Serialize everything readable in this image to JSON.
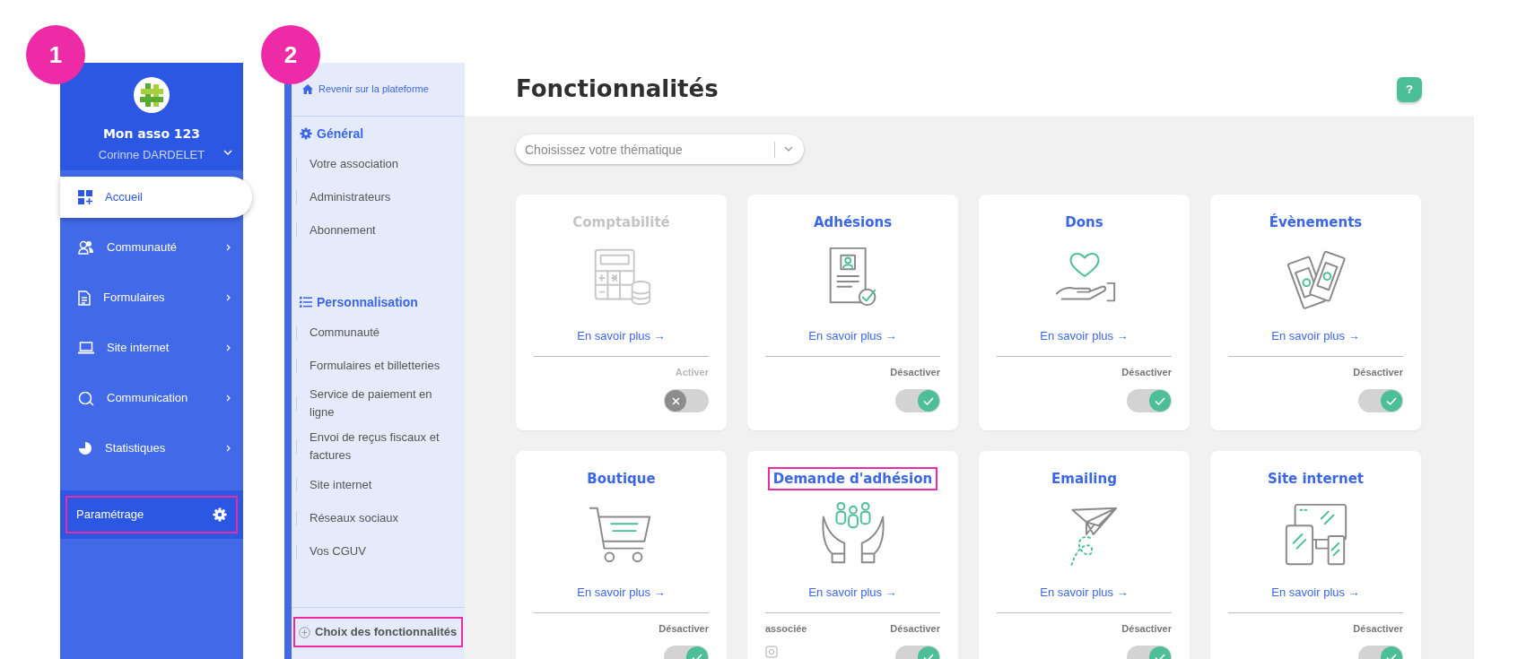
{
  "annotations": [
    {
      "number": "1"
    },
    {
      "number": "2"
    }
  ],
  "sidebar": {
    "org_name": "Mon asso 123",
    "user_name": "Corinne DARDELET",
    "items": [
      {
        "label": "Accueil",
        "selected": true,
        "expandable": false
      },
      {
        "label": "Communauté",
        "selected": false,
        "expandable": true
      },
      {
        "label": "Formulaires",
        "selected": false,
        "expandable": true
      },
      {
        "label": "Site internet",
        "selected": false,
        "expandable": true
      },
      {
        "label": "Communication",
        "selected": false,
        "expandable": true
      },
      {
        "label": "Statistiques",
        "selected": false,
        "expandable": true
      }
    ],
    "settings": {
      "label": "Paramétrage",
      "highlighted": true
    }
  },
  "settings_menu": {
    "back_link": "Revenir sur la plateforme",
    "sections": [
      {
        "title": "Général",
        "items": [
          "Votre association",
          "Administrateurs",
          "Abonnement"
        ]
      },
      {
        "title": "Personnalisation",
        "items": [
          "Communauté",
          "Formulaires et billetteries",
          "Service de paiement en ligne",
          "Envoi de reçus fiscaux et factures",
          "Site internet",
          "Réseaux sociaux",
          "Vos CGUV"
        ]
      }
    ],
    "footer": {
      "label": "Choix des fonctionnalités",
      "highlighted": true
    }
  },
  "main": {
    "title": "Fonctionnalités",
    "help": "?",
    "filter": {
      "placeholder": "Choisissez votre thématique"
    },
    "cards": [
      {
        "title": "Comptabilité",
        "link": "En savoir plus →",
        "toggle_label": "Activer",
        "checked": false,
        "highlighted": false
      },
      {
        "title": "Adhésions",
        "link": "En savoir plus →",
        "toggle_label": "Désactiver",
        "checked": true,
        "highlighted": false
      },
      {
        "title": "Dons",
        "link": "En savoir plus →",
        "toggle_label": "Désactiver",
        "checked": true,
        "highlighted": false
      },
      {
        "title": "Évènements",
        "link": "En savoir plus →",
        "toggle_label": "Désactiver",
        "checked": true,
        "highlighted": false
      },
      {
        "title": "Boutique",
        "link": "En savoir plus →",
        "toggle_label": "Désactiver",
        "checked": true,
        "highlighted": false
      },
      {
        "title": "Demande d'adhésion",
        "link": "En savoir plus →",
        "toggle_label": "Désactiver",
        "checked": true,
        "highlighted": true,
        "note": "associée"
      },
      {
        "title": "Emailing",
        "link": "En savoir plus →",
        "toggle_label": "Désactiver",
        "checked": true,
        "highlighted": false
      },
      {
        "title": "Site internet",
        "link": "En savoir plus →",
        "toggle_label": "Désactiver",
        "checked": true,
        "highlighted": false
      }
    ]
  }
}
